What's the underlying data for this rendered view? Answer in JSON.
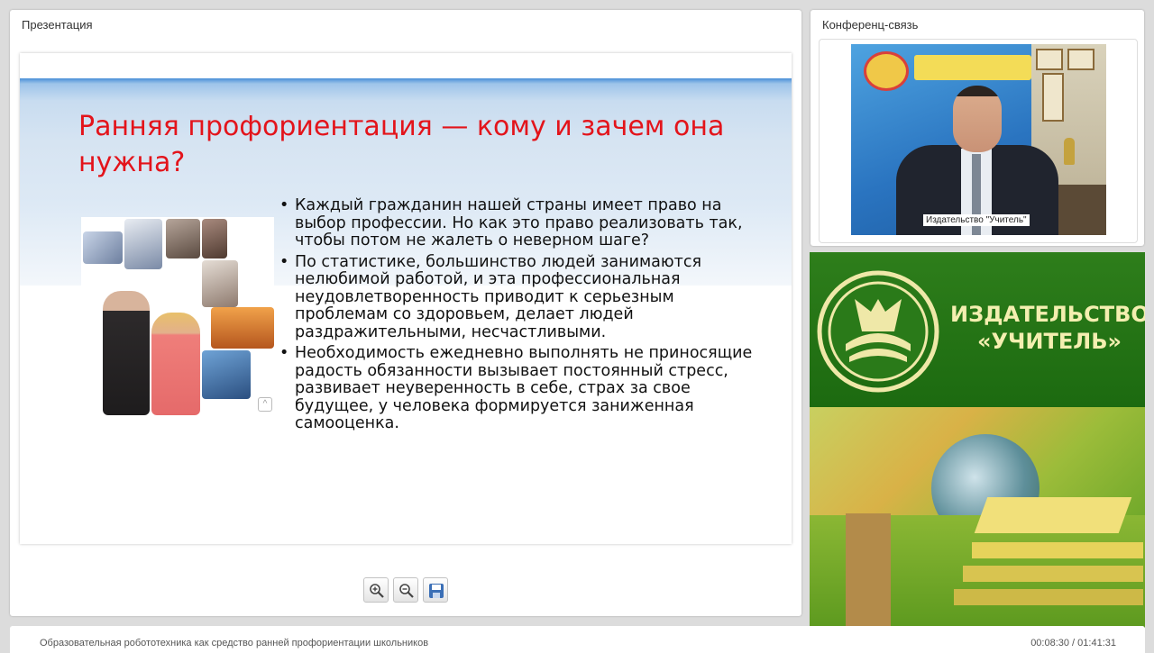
{
  "presentation": {
    "panel_title": "Презентация",
    "slide": {
      "title": "Ранняя профориентация — кому и зачем она нужна?",
      "bullets": [
        "Каждый гражданин нашей страны имеет право на выбор профессии. Но как это право реализовать так, чтобы потом не жалеть о неверном шаге?",
        "По статистике, большинство людей занимаются нелюбимой работой, и эта профессиональная неудовлетворенность приводит к серьезным проблемам со здоровьем, делает людей раздражительными, несчастливыми.",
        "Необходимость ежедневно выполнять не приносящие радость обязанности вызывает постоянный стресс, развивает неуверенность в себе, страх за свое будущее, у человека формируется заниженная самооценка."
      ],
      "title_color": "#e3141b"
    },
    "toolbar": {
      "zoom_in_icon": "zoom-in-icon",
      "zoom_out_icon": "zoom-out-icon",
      "save_icon": "floppy-disk-icon"
    }
  },
  "conference": {
    "panel_title": "Конференц-связь",
    "video_caption": "Издательство \"Учитель\""
  },
  "banner": {
    "publisher_line1": "ИЗДАТЕЛЬСТВО",
    "publisher_line2": "«УЧИТЕЛЬ»",
    "brand_color": "#1d6d12"
  },
  "status_bar": {
    "title": "Образовательная робототехника как средство ранней профориентации школьников",
    "time": "00:08:30 / 01:41:31"
  }
}
